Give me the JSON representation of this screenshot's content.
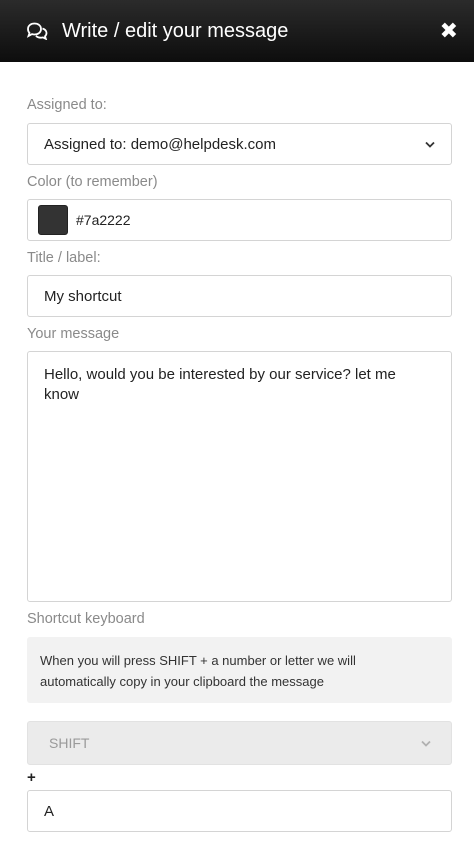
{
  "header": {
    "title": "Write / edit your message",
    "close_glyph": "✖",
    "icon": "chat-bubbles-icon",
    "close_icon": "close-icon"
  },
  "assigned": {
    "label": "Assigned to:",
    "value": "Assigned to: demo@helpdesk.com"
  },
  "color": {
    "label": "Color (to remember)",
    "value": "#7a2222",
    "swatch_color": "#333333"
  },
  "title_field": {
    "label": "Title / label:",
    "value": "My shortcut"
  },
  "message": {
    "label": "Your message",
    "value": "Hello, would you be interested by our service? let me know"
  },
  "shortcut": {
    "label": "Shortcut keyboard",
    "info_line1": "When you will press SHIFT + a number or letter we will",
    "info_line2": "automatically copy in your clipboard the message",
    "modifier": "SHIFT",
    "plus": "+",
    "key": "A"
  }
}
